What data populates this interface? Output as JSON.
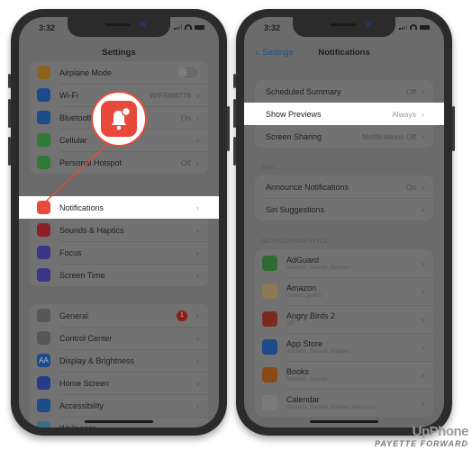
{
  "colors": {
    "accent_red": "#e8493a",
    "back_link_blue": "#1e4e8c",
    "highlight_row": "#ffffff",
    "dim_overlay": "#6b6b6b"
  },
  "left_phone": {
    "status_time": "3:32",
    "nav_title": "Settings",
    "group1": [
      {
        "icon": "airplane-icon",
        "label": "Airplane Mode",
        "value": "",
        "control": "toggle",
        "toggle_on": false,
        "color": "#8a6418"
      },
      {
        "icon": "wifi-icon",
        "label": "Wi-Fi",
        "value": "WIFI986778",
        "color": "#1d4a8a"
      },
      {
        "icon": "bluetooth-icon",
        "label": "Bluetooth",
        "value": "On",
        "color": "#1d4a8a"
      },
      {
        "icon": "cellular-icon",
        "label": "Cellular",
        "value": "",
        "color": "#2f7a36"
      },
      {
        "icon": "hotspot-icon",
        "label": "Personal Hotspot",
        "value": "Off",
        "color": "#2f7a36"
      }
    ],
    "group2": [
      {
        "icon": "notifications-icon",
        "label": "Notifications",
        "value": "",
        "highlighted": true,
        "color": "#e8493a"
      },
      {
        "icon": "sounds-icon",
        "label": "Sounds & Haptics",
        "value": "",
        "color": "#8a1f2a"
      },
      {
        "icon": "focus-moon-icon",
        "label": "Focus",
        "value": "",
        "color": "#3a3585"
      },
      {
        "icon": "screen-time-hourglass-icon",
        "label": "Screen Time",
        "value": "",
        "color": "#3a3585"
      }
    ],
    "group3": [
      {
        "icon": "general-gear-icon",
        "label": "General",
        "value": "",
        "badge": "1",
        "color": "#575757"
      },
      {
        "icon": "control-center-icon",
        "label": "Control Center",
        "value": "",
        "color": "#575757"
      },
      {
        "icon": "display-brightness-icon",
        "label": "Display & Brightness",
        "value": "",
        "color": "#1d4a8a",
        "glyph": "AA"
      },
      {
        "icon": "home-screen-icon",
        "label": "Home Screen",
        "value": "",
        "color": "#283a8a"
      },
      {
        "icon": "accessibility-icon",
        "label": "Accessibility",
        "value": "",
        "color": "#1d4a8a"
      },
      {
        "icon": "wallpaper-icon",
        "label": "Wallpaper",
        "value": "",
        "color": "#3a6d8a"
      }
    ]
  },
  "right_phone": {
    "status_time": "3:32",
    "back_label": "Settings",
    "nav_title": "Notifications",
    "group1": [
      {
        "label": "Scheduled Summary",
        "value": "Off"
      },
      {
        "label": "Show Previews",
        "value": "Always",
        "highlighted": true
      },
      {
        "label": "Screen Sharing",
        "value": "Notifications Off"
      }
    ],
    "siri_header": "SIRI",
    "siri_group": [
      {
        "label": "Announce Notifications",
        "value": "On"
      },
      {
        "label": "Siri Suggestions",
        "value": ""
      }
    ],
    "style_header": "NOTIFICATION STYLE",
    "apps": [
      {
        "icon": "adguard-icon",
        "name": "AdGuard",
        "sub": "Banners, Sounds, Badges",
        "color": "#2f6a30"
      },
      {
        "icon": "amazon-icon",
        "name": "Amazon",
        "sub": "Deliver Quietly",
        "color": "#8a7a55"
      },
      {
        "icon": "angry-birds-icon",
        "name": "Angry Birds 2",
        "sub": "Off",
        "color": "#7a2a22"
      },
      {
        "icon": "app-store-icon",
        "name": "App Store",
        "sub": "Banners, Sounds, Badges",
        "color": "#1d4a8a"
      },
      {
        "icon": "books-icon",
        "name": "Books",
        "sub": "Banners, Sounds",
        "color": "#8a4a18"
      },
      {
        "icon": "calendar-icon",
        "name": "Calendar",
        "sub": "Banners, Sounds, Badges, Announce",
        "color": "#7a7a7a"
      }
    ]
  },
  "watermark": {
    "line1": "UpPhone",
    "line2": "PAYETTE FORWARD"
  }
}
